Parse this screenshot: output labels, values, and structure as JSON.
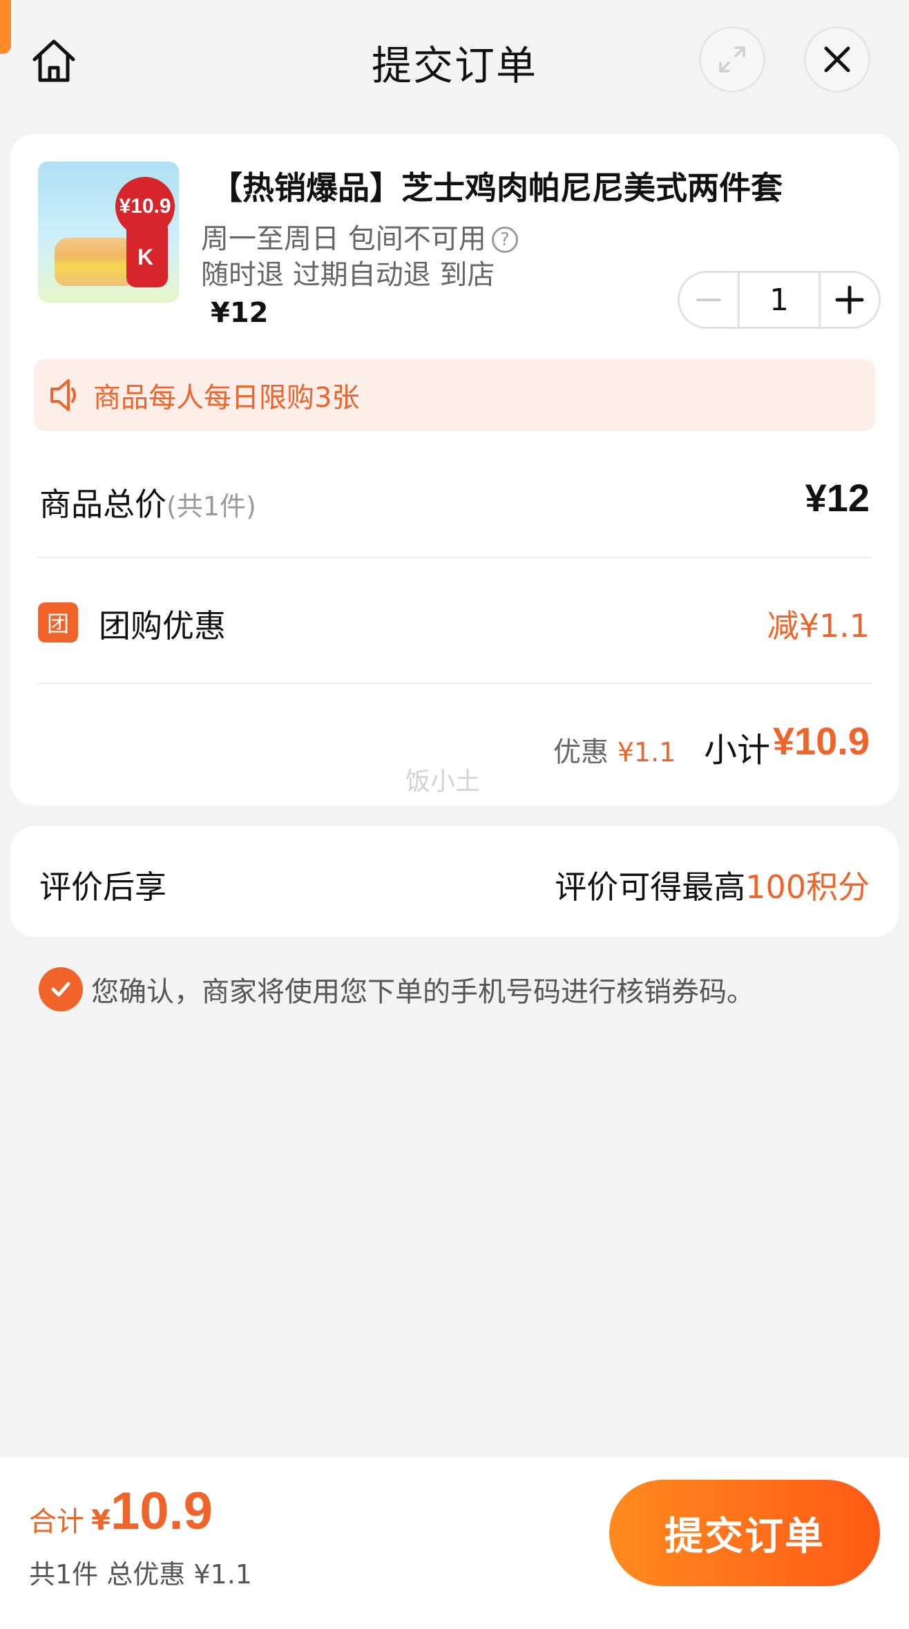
{
  "header": {
    "title": "提交订单",
    "icons": [
      "home-icon",
      "expand-icon",
      "close-icon"
    ]
  },
  "order": {
    "product_title": "【热销爆品】芝士鸡肉帕尼尼美式两件套",
    "thumb_badge": "¥10.9",
    "meta_line1": "周一至周日 包间不可用",
    "meta_line2": "随时退 过期自动退 到店",
    "price": "¥12",
    "quantity": "1",
    "limit_notice": "商品每人每日限购3张",
    "total_label": "商品总价",
    "total_count": "(共1件)",
    "total_value": "¥12",
    "group_icon_text": "团",
    "group_label": "团购优惠",
    "group_value": "减¥1.1",
    "discount_label": "优惠",
    "discount_value": "¥1.1",
    "subtotal_label": "小计",
    "subtotal_value": "¥10.9",
    "watermark": "饭小土"
  },
  "review": {
    "label": "评价后享",
    "value_prefix": "评价可得最高",
    "value_highlight": "100积分"
  },
  "confirm": {
    "text": "您确认，商家将使用您下单的手机号码进行核销券码。"
  },
  "bottom": {
    "sum_label": "合计",
    "sum_yen": "¥",
    "sum_value": "10.9",
    "sum_sub": "共1件 总优惠 ¥1.1",
    "submit_label": "提交订单"
  },
  "colors": {
    "accent": "#f0642a",
    "limit_bg": "#fdeeea",
    "page_bg": "#f3f3f3"
  }
}
